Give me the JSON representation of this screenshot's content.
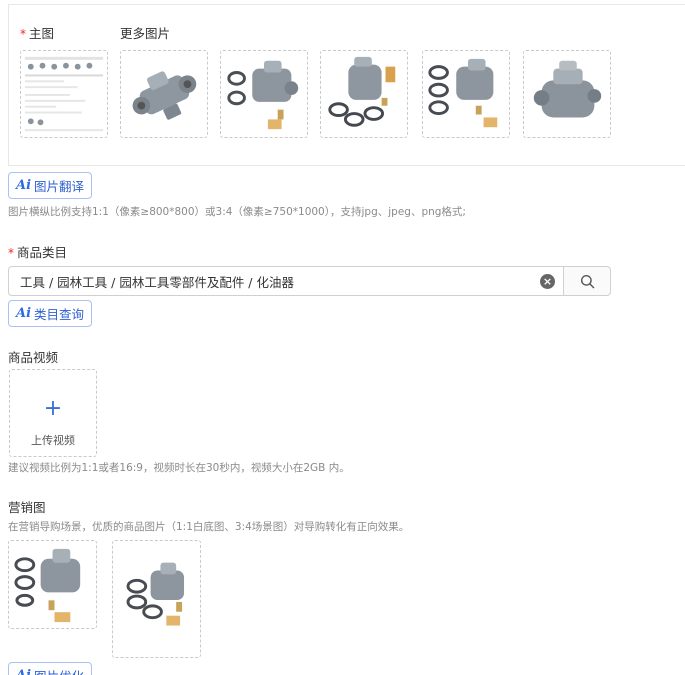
{
  "main_image": {
    "required_mark": "*",
    "label": "主图"
  },
  "more_images": {
    "label": "更多图片"
  },
  "ai_image_translate": {
    "logo": "Ai",
    "label": "图片翻译"
  },
  "image_hint": "图片横纵比例支持1:1（像素≥800*800）或3:4（像素≥750*1000），支持jpg、jpeg、png格式;",
  "category": {
    "required_mark": "*",
    "label": "商品类目",
    "value": "工具 / 园林工具 / 园林工具零部件及配件 / 化油器"
  },
  "ai_category": {
    "logo": "Ai",
    "label": "类目查询"
  },
  "video": {
    "label": "商品视频",
    "upload_label": "上传视频",
    "hint": "建议视频比例为1:1或者16:9，视频时长在30秒内，视频大小在2GB 内。"
  },
  "marketing": {
    "label": "营销图",
    "hint": "在营销导购场景，优质的商品图片（1:1白底图、3:4场景图）对导购转化有正向效果。"
  },
  "ai_image_optimize": {
    "logo": "Ai",
    "label": "图片优化"
  },
  "icons": {
    "clear": "close-circle-icon",
    "search": "search-icon",
    "plus": "plus-icon"
  },
  "colors": {
    "accent": "#2f5fd1",
    "required": "#f5222d",
    "hint": "#8a8a8a",
    "border": "#c9c9c9"
  }
}
